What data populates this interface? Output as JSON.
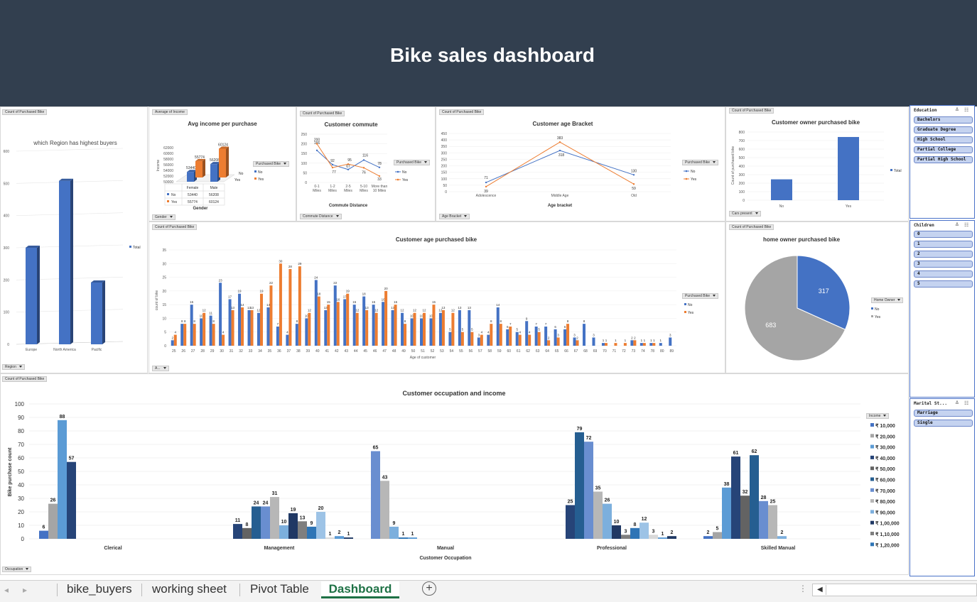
{
  "dashboard": {
    "title": "Bike sales dashboard"
  },
  "colors": {
    "banner": "#323f4f",
    "no": "#4472c4",
    "yes": "#ed7d31",
    "grey": "#a5a5a5"
  },
  "tags": {
    "region_field": "Count of Purchased Bike",
    "region_axis": "Region",
    "income_field": "Average of Income",
    "income_axis": "Gender",
    "commute_field": "Count of Purchased Bike",
    "commute_axis": "Commute Distance",
    "agebracket_field": "Count of Purchased Bike",
    "agebracket_axis": "Age Bracket",
    "cars_field": "Count of Purchased Bike",
    "cars_axis": "Cars present",
    "age_field": "Count of Purchased Bike",
    "age_axis": "A...",
    "home_field": "Count of Purchased Bike",
    "occupation_field": "Count of Purchased Bike",
    "occupation_axis": "Occupation",
    "purchased_bike": "Purchased Bike",
    "home_owner": "Home Owner",
    "income": "Income"
  },
  "legends": {
    "no": "No",
    "yes": "Yes",
    "total": "Total"
  },
  "chart_data": [
    {
      "type": "bar",
      "title": "which Region has highest buyers",
      "categories": [
        "Europe",
        "North America",
        "Pacific"
      ],
      "values": [
        300,
        508,
        192
      ],
      "ylim": [
        0,
        600
      ],
      "yticks": [
        0,
        100,
        200,
        300,
        400,
        500,
        600
      ],
      "legend": "Total"
    },
    {
      "type": "bar",
      "title": "Avg  income per purchase",
      "categories": [
        "Female",
        "Male"
      ],
      "xlabel": "Gender",
      "ylabel": "Income",
      "yticks": [
        50000,
        52000,
        54000,
        56000,
        58000,
        60000,
        62000
      ],
      "series": [
        {
          "name": "No",
          "values": [
            53440,
            56208
          ]
        },
        {
          "name": "Yes",
          "values": [
            55774,
            60124
          ]
        }
      ],
      "table": {
        "header": [
          "Female",
          "Male"
        ],
        "rows": [
          {
            "label": "No",
            "values": [
              "53440",
              "56208"
            ]
          },
          {
            "label": "Yes",
            "values": [
              "55774",
              "60124"
            ]
          }
        ]
      },
      "floor_labels": [
        "No",
        "Yes"
      ]
    },
    {
      "type": "line",
      "title": "Customer commute",
      "categories": [
        "0-1 Miles",
        "1-2 Miles",
        "2-5 Miles",
        "5-10 Miles",
        "More than 10 Miles"
      ],
      "xlabel": "Commute Distance",
      "ylim": [
        0,
        250
      ],
      "yticks": [
        0,
        50,
        100,
        150,
        200,
        250
      ],
      "series": [
        {
          "name": "No",
          "values": [
            166,
            92,
            67,
            116,
            78
          ]
        },
        {
          "name": "Yes",
          "values": [
            200,
            77,
            95,
            76,
            33
          ]
        }
      ]
    },
    {
      "type": "line",
      "title": "Customer age Bracket",
      "categories": [
        "Adolescence",
        "Middle Age",
        "Old"
      ],
      "xlabel": "Age bracket",
      "ylim": [
        0,
        450
      ],
      "yticks": [
        0,
        50,
        100,
        150,
        200,
        250,
        300,
        350,
        400,
        450
      ],
      "series": [
        {
          "name": "No",
          "values": [
            71,
            318,
            130
          ]
        },
        {
          "name": "Yes",
          "values": [
            39,
            383,
            59
          ]
        }
      ]
    },
    {
      "type": "bar",
      "title": "Customer owner purchased bike",
      "categories": [
        "No",
        "Yes"
      ],
      "ylabel": "Count of purchased bike",
      "ylim": [
        0,
        800
      ],
      "yticks": [
        0,
        100,
        200,
        300,
        400,
        500,
        600,
        700,
        800
      ],
      "values": [
        245,
        742
      ],
      "legend": "Total"
    },
    {
      "type": "bar",
      "title": "Customer age purchased bike",
      "xlabel": "Age of customer",
      "ylabel": "count of bike",
      "ylim": [
        0,
        35
      ],
      "yticks": [
        0,
        5,
        10,
        15,
        20,
        25,
        30,
        35
      ],
      "categories": [
        "25",
        "26",
        "27",
        "28",
        "29",
        "30",
        "31",
        "32",
        "33",
        "34",
        "35",
        "36",
        "37",
        "38",
        "39",
        "40",
        "41",
        "42",
        "43",
        "44",
        "45",
        "46",
        "47",
        "48",
        "49",
        "50",
        "51",
        "52",
        "53",
        "54",
        "55",
        "56",
        "57",
        "58",
        "59",
        "60",
        "61",
        "62",
        "63",
        "64",
        "65",
        "66",
        "67",
        "68",
        "69",
        "70",
        "71",
        "72",
        "73",
        "74",
        "78",
        "80",
        "89"
      ],
      "series": [
        {
          "name": "No",
          "values": [
            2,
            8,
            15,
            10,
            11,
            23,
            17,
            19,
            13,
            12,
            14,
            7,
            4,
            8,
            10,
            24,
            13,
            22,
            17,
            15,
            18,
            15,
            16,
            13,
            12,
            10,
            10,
            10,
            12,
            5,
            13,
            13,
            3,
            4,
            14,
            6,
            5,
            9,
            7,
            7,
            6,
            6,
            3,
            8,
            3,
            1,
            0,
            0,
            2,
            1,
            1,
            1,
            3
          ]
        },
        {
          "name": "Yes",
          "values": [
            4,
            8,
            8,
            12,
            8,
            4,
            13,
            14,
            13,
            19,
            22,
            30,
            28,
            29,
            12,
            18,
            15,
            16,
            19,
            12,
            13,
            12,
            20,
            15,
            8,
            12,
            12,
            15,
            13,
            12,
            5,
            5,
            4,
            8,
            8,
            7,
            4,
            4,
            5,
            2,
            3,
            8,
            2,
            0,
            0,
            1,
            1,
            1,
            2,
            1,
            1,
            0,
            0
          ]
        }
      ]
    },
    {
      "type": "pie",
      "title": "home owner purchased bike",
      "categories": [
        "No",
        "Yes"
      ],
      "values": [
        317,
        683
      ],
      "legend_title": "Home Owner"
    },
    {
      "type": "bar",
      "title": "Customer occupation and income",
      "xlabel": "Customer Occupation",
      "ylabel": "Bike purchase count",
      "ylim": [
        0,
        100
      ],
      "yticks": [
        0,
        10,
        20,
        30,
        40,
        50,
        60,
        70,
        80,
        90,
        100
      ],
      "categories": [
        "Clerical",
        "Management",
        "Manual",
        "Professional",
        "Skilled Manual"
      ],
      "series": [
        {
          "name": "₹ 10,000",
          "color": "#4472c4",
          "values": [
            6,
            0,
            0,
            0,
            2
          ]
        },
        {
          "name": "₹ 20,000",
          "color": "#a5a5a5",
          "values": [
            26,
            0,
            0,
            0,
            5
          ]
        },
        {
          "name": "₹ 30,000",
          "color": "#5b9bd5",
          "values": [
            88,
            0,
            0,
            0,
            38
          ]
        },
        {
          "name": "₹ 40,000",
          "color": "#264478",
          "values": [
            57,
            11,
            0,
            25,
            61
          ]
        },
        {
          "name": "₹ 50,000",
          "color": "#636363",
          "values": [
            0,
            8,
            0,
            0,
            32
          ]
        },
        {
          "name": "₹ 60,000",
          "color": "#255e91",
          "values": [
            0,
            24,
            0,
            79,
            62
          ]
        },
        {
          "name": "₹ 70,000",
          "color": "#698ed0",
          "values": [
            0,
            24,
            65,
            72,
            28
          ]
        },
        {
          "name": "₹ 80,000",
          "color": "#b7b7b7",
          "values": [
            0,
            31,
            43,
            35,
            25
          ]
        },
        {
          "name": "₹ 90,000",
          "color": "#7cafdd",
          "values": [
            0,
            10,
            9,
            26,
            2
          ]
        },
        {
          "name": "₹ 1,00,000",
          "color": "#203864",
          "values": [
            0,
            19,
            0,
            10,
            0
          ]
        },
        {
          "name": "₹ 1,10,000",
          "color": "#7f7f7f",
          "values": [
            0,
            13,
            0,
            3,
            0
          ]
        },
        {
          "name": "₹ 1,20,000",
          "color": "#2e75b6",
          "values": [
            0,
            9,
            1,
            8,
            0
          ]
        },
        {
          "name": "",
          "color": "#9dc3e6",
          "values": [
            0,
            20,
            0,
            12,
            0
          ]
        },
        {
          "name": "",
          "color": "#d9d9d9",
          "values": [
            0,
            1,
            0,
            3,
            0
          ]
        },
        {
          "name": "",
          "color": "#5a9bd5",
          "values": [
            0,
            2,
            1,
            1,
            0
          ]
        },
        {
          "name": "",
          "color": "#1f3864",
          "values": [
            0,
            1,
            0,
            2,
            0
          ]
        }
      ]
    }
  ],
  "slicers": {
    "education": {
      "title": "Education",
      "items": [
        "Bachelors",
        "Graduate Degree",
        "High School",
        "Partial College",
        "Partial High School"
      ]
    },
    "children": {
      "title": "Children",
      "items": [
        "0",
        "1",
        "2",
        "3",
        "4",
        "5"
      ]
    },
    "marital": {
      "title": "Marital St...",
      "items": [
        "Marriage",
        "Single"
      ]
    }
  },
  "sheet_tabs": [
    "bike_buyers",
    "working sheet",
    "Pivot Table",
    "Dashboard"
  ],
  "active_tab": "Dashboard"
}
